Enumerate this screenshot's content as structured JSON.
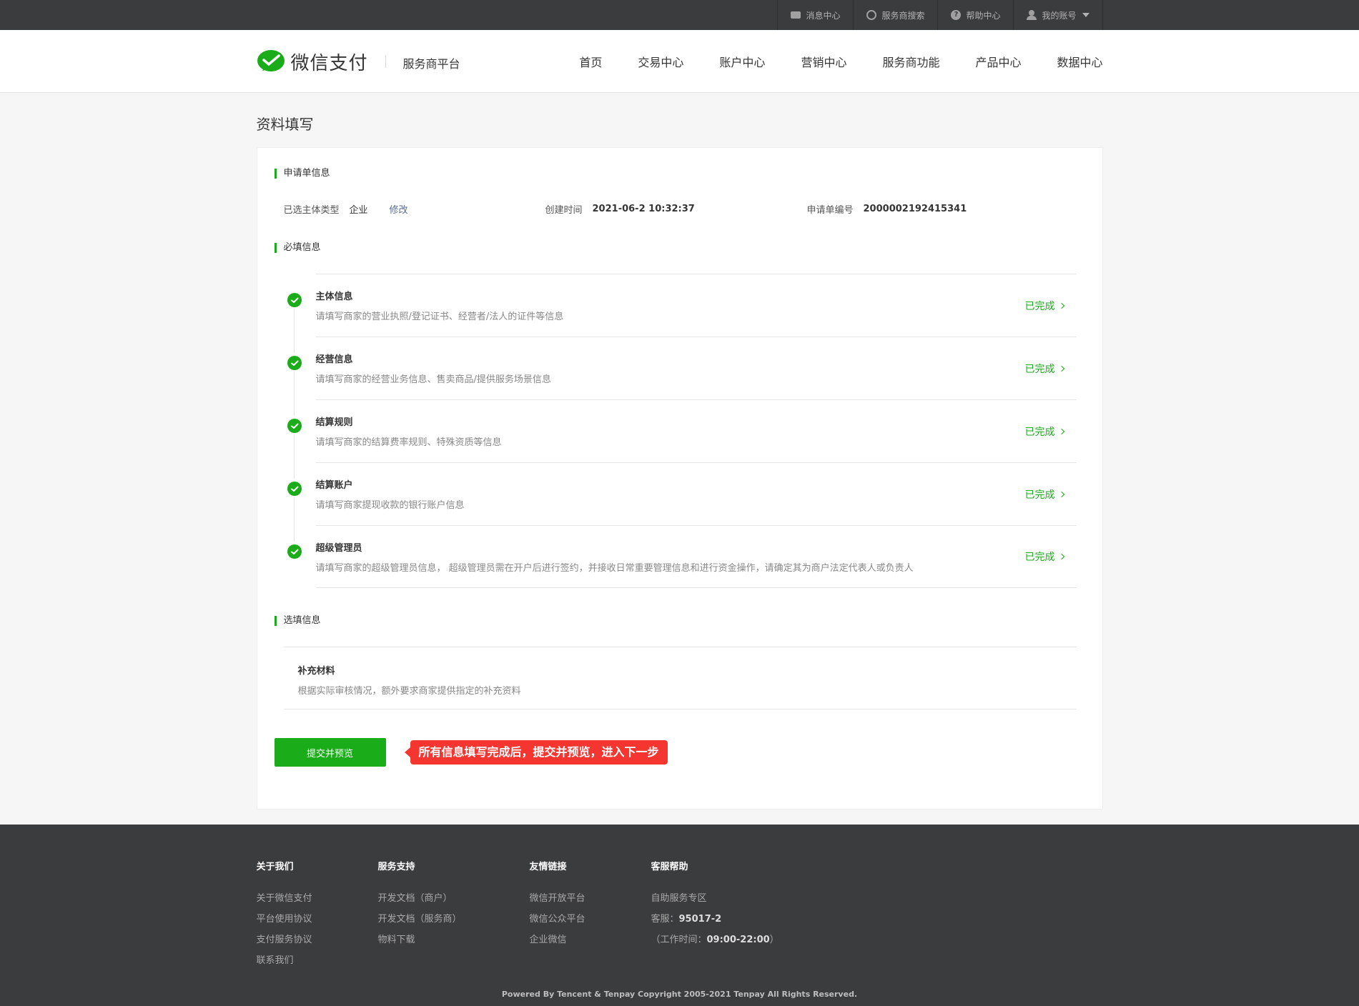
{
  "topbar": {
    "items": [
      {
        "label": "消息中心",
        "icon": "mail-icon"
      },
      {
        "label": "服务商搜索",
        "icon": "search-icon"
      },
      {
        "label": "帮助中心",
        "icon": "help-icon"
      },
      {
        "label": "我的账号",
        "icon": "user-icon"
      }
    ]
  },
  "header": {
    "logo_text": "微信支付",
    "logo_sub": "服务商平台",
    "nav": [
      "首页",
      "交易中心",
      "账户中心",
      "营销中心",
      "服务商功能",
      "产品中心",
      "数据中心"
    ]
  },
  "page": {
    "title": "资料填写"
  },
  "application": {
    "section_title": "申请单信息",
    "subject_type_label": "已选主体类型",
    "subject_type_value": "企业",
    "modify_link": "修改",
    "created_label": "创建时间",
    "created_value": "2021-06-2 10:32:37",
    "number_label": "申请单编号",
    "number_value": "2000002192415341"
  },
  "required": {
    "section_title": "必填信息",
    "items": [
      {
        "name": "主体信息",
        "desc": "请填写商家的营业执照/登记证书、经营者/法人的证件等信息",
        "status": "已完成"
      },
      {
        "name": "经营信息",
        "desc": "请填写商家的经营业务信息、售卖商品/提供服务场景信息",
        "status": "已完成"
      },
      {
        "name": "结算规则",
        "desc": "请填写商家的结算费率规则、特殊资质等信息",
        "status": "已完成"
      },
      {
        "name": "结算账户",
        "desc": "请填写商家提现收款的银行账户信息",
        "status": "已完成"
      },
      {
        "name": "超级管理员",
        "desc": "请填写商家的超级管理员信息， 超级管理员需在开户后进行签约，并接收日常重要管理信息和进行资金操作，请确定其为商户法定代表人或负责人",
        "status": "已完成"
      }
    ]
  },
  "optional": {
    "section_title": "选填信息",
    "item_name": "补充材料",
    "item_desc": "根据实际审核情况，额外要求商家提供指定的补充资料"
  },
  "actions": {
    "submit_label": "提交并预览",
    "tip": "所有信息填写完成后，提交并预览，进入下一步"
  },
  "footer": {
    "about": {
      "title": "关于我们",
      "links": [
        "关于微信支付",
        "平台使用协议",
        "支付服务协议",
        "联系我们"
      ]
    },
    "support": {
      "title": "服务支持",
      "links": [
        "开发文档（商户）",
        "开发文档（服务商）",
        "物料下载"
      ]
    },
    "friends": {
      "title": "友情链接",
      "links": [
        "微信开放平台",
        "微信公众平台",
        "企业微信"
      ]
    },
    "help": {
      "title": "客服帮助",
      "self_service": "自助服务专区",
      "hotline_label": "客服：",
      "hotline": "95017-2",
      "hours_prefix": "（工作时间：",
      "hours": "09:00-22:00",
      "hours_suffix": "）"
    },
    "copyright": "Powered By Tencent & Tenpay   Copyright 2005-2021 Tenpay All Rights Reserved."
  },
  "colors": {
    "brand": "#1aad19",
    "topbar": "#3b3c3e",
    "tip": "#f43530",
    "link": "#576b95"
  }
}
